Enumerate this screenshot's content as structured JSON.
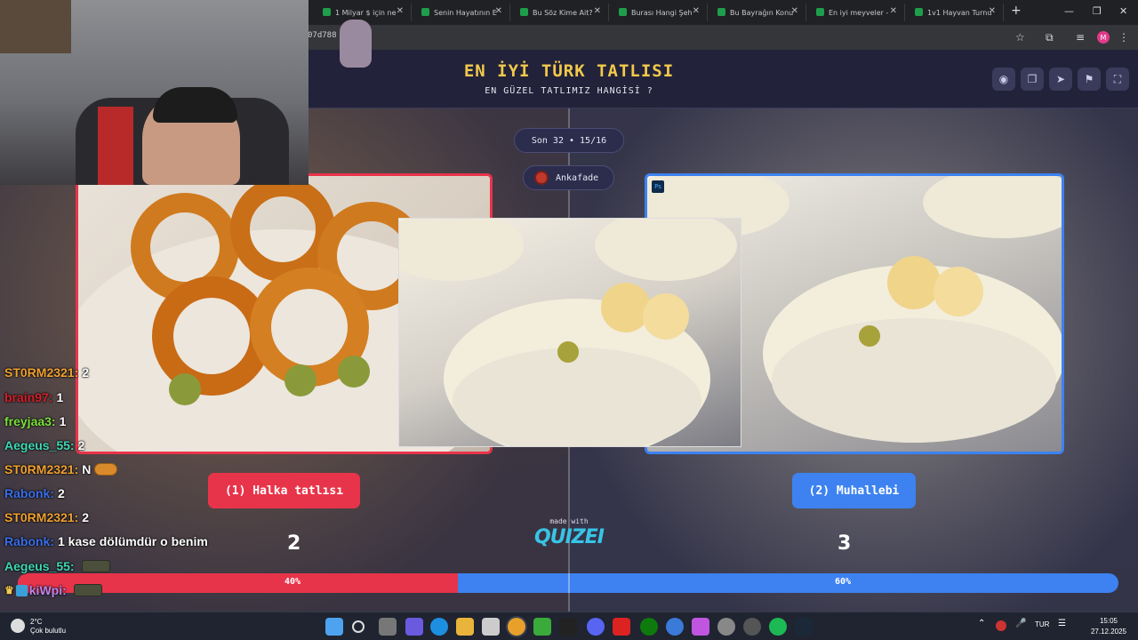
{
  "browser": {
    "tabs": [
      {
        "label": "1 Milyar $ için ne"
      },
      {
        "label": "Senin Hayatının E"
      },
      {
        "label": "Bu Söz Kime Ait?"
      },
      {
        "label": "Burası Hangi Şeh"
      },
      {
        "label": "Bu Bayrağın Konu"
      },
      {
        "label": "En iyi meyveler - "
      },
      {
        "label": "1v1 Hayvan Turnu"
      }
    ],
    "url_fragment": "07d788",
    "profile_initial": "M"
  },
  "quiz": {
    "title": "EN İYİ TÜRK TATLISI",
    "subtitle": "EN GÜZEL TATLIMIZ HANGİSİ ?",
    "round": "Son 32 • 15/16",
    "user": "Ankafade",
    "made_with": "made with",
    "brand": "QUIZEI",
    "left": {
      "label": "(1) Halka tatlısı",
      "votes": "2",
      "percent": "40%",
      "share": 0.4
    },
    "right": {
      "label": "(2) Muhallebi",
      "votes": "3",
      "percent": "60%"
    }
  },
  "chat": [
    {
      "user": "ST0RM2321:",
      "text": "2",
      "color": "#f0a030"
    },
    {
      "user": "brain97:",
      "text": "1",
      "color": "#d4202a"
    },
    {
      "user": "freyjaa3:",
      "text": "1",
      "color": "#7be03a"
    },
    {
      "user": "Aegeus_55:",
      "text": "2",
      "color": "#3fd9b5"
    },
    {
      "user": "ST0RM2321:",
      "text": "N",
      "color": "#f0a030",
      "emote": "food"
    },
    {
      "user": "Rabonk:",
      "text": "2",
      "color": "#3a6ee8"
    },
    {
      "user": "ST0RM2321:",
      "text": "2",
      "color": "#f0a030"
    },
    {
      "user": "Rabonk:",
      "text": "1 kase dölümdür o benim",
      "color": "#3a6ee8"
    },
    {
      "user": "Aegeus_55:",
      "text": "",
      "color": "#3fd9b5",
      "emote": "tank"
    },
    {
      "user": "kiWpi:",
      "text": "",
      "color": "#b68af0",
      "emote": "tank"
    }
  ],
  "taskbar": {
    "weather_temp": "2°C",
    "weather_desc": "Çok bulutlu",
    "lang": "TUR",
    "time": "15:05",
    "date": "27.12.2025"
  },
  "colors": {
    "red": "#e8344a",
    "blue": "#3d82f0",
    "gold": "#f2c94c"
  }
}
